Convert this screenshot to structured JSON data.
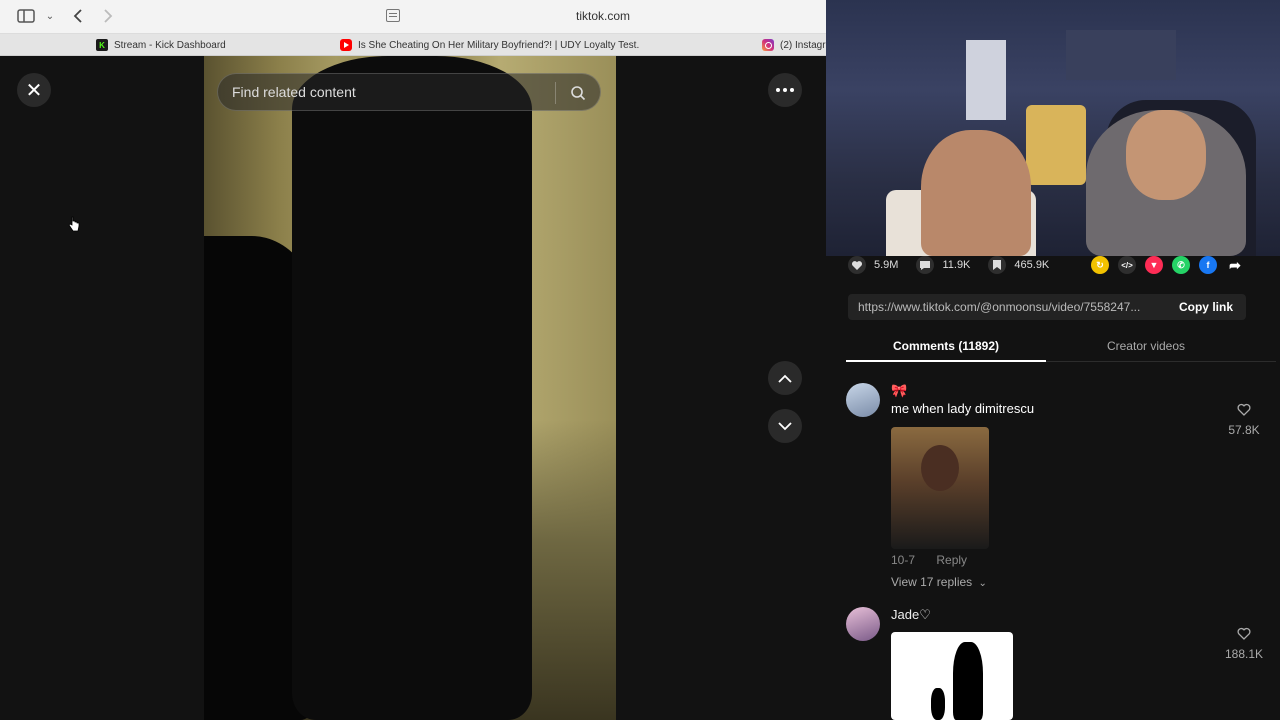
{
  "browser": {
    "url": "tiktok.com",
    "tabs": [
      {
        "label": "Stream - Kick Dashboard"
      },
      {
        "label": "Is She Cheating On Her Military Boyfriend?! | UDY Loyalty Test..."
      },
      {
        "label": "(2) Instagr"
      }
    ]
  },
  "player": {
    "search_placeholder": "Find related content",
    "close_symbol": "✕"
  },
  "stats": {
    "likes": "5.9M",
    "comments": "11.9K",
    "saves": "465.9K"
  },
  "share": {
    "link": "https://www.tiktok.com/@onmoonsu/video/7558247...",
    "copy_label": "Copy link"
  },
  "panel_tabs": {
    "comments": "Comments (11892)",
    "creator": "Creator videos"
  },
  "comments": [
    {
      "name": "🎀",
      "text": "me when lady dimitrescu",
      "date": "10-7",
      "reply": "Reply",
      "replies": "View 17 replies",
      "likes": "57.8K"
    },
    {
      "name": "Jade♡",
      "likes": "188.1K"
    }
  ],
  "colors": {
    "page_bg": "#121212",
    "tab_underline": "#ffffff",
    "repost_icon": "#f2c200",
    "send_icon": "#fe2c55",
    "whatsapp_icon": "#25d366",
    "facebook_icon": "#1877f2"
  }
}
